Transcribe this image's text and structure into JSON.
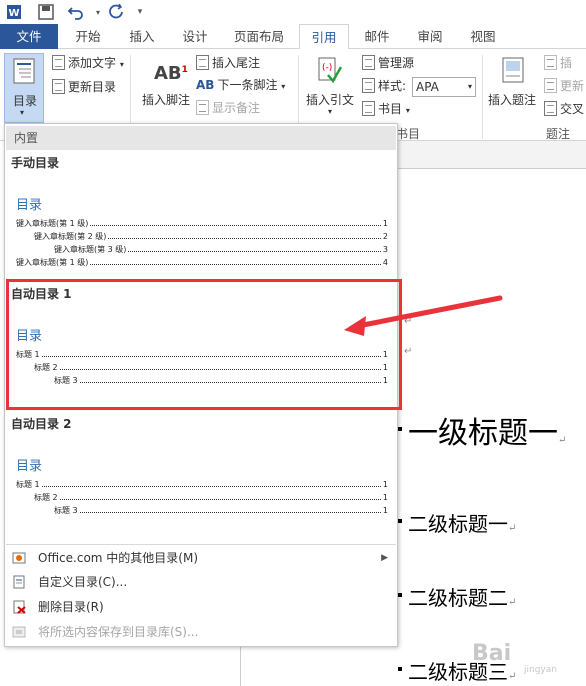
{
  "qat": {
    "icons": [
      "word-icon",
      "save-icon",
      "undo-icon",
      "redo-icon",
      "customize-icon"
    ]
  },
  "tabs": [
    {
      "label": "文件",
      "state": "file"
    },
    {
      "label": "开始",
      "state": ""
    },
    {
      "label": "插入",
      "state": ""
    },
    {
      "label": "设计",
      "state": ""
    },
    {
      "label": "页面布局",
      "state": ""
    },
    {
      "label": "引用",
      "state": "active"
    },
    {
      "label": "邮件",
      "state": ""
    },
    {
      "label": "审阅",
      "state": ""
    },
    {
      "label": "视图",
      "state": ""
    }
  ],
  "ribbon": {
    "toc_button": "目录",
    "add_text": "添加文字",
    "update_toc": "更新目录",
    "insert_footnote": "插入脚注",
    "insert_endnote": "插入尾注",
    "next_footnote": "下一条脚注",
    "show_notes": "显示备注",
    "insert_citation": "插入引文",
    "manage_sources": "管理源",
    "style_label": "样式:",
    "style_value": "APA",
    "bibliography": "书目",
    "group_citations": "书目",
    "insert_caption": "插入题注",
    "group_captions": "题注",
    "caption_right_1": "插",
    "caption_right_2": "更新",
    "caption_right_3": "交叉"
  },
  "gallery": {
    "header": "内置",
    "options": [
      {
        "title": "手动目录",
        "toc_heading": "目录",
        "rows": [
          {
            "text": "键入章标题(第 1 级)",
            "page": "1",
            "level": 1
          },
          {
            "text": "键入章标题(第 2 级)",
            "page": "2",
            "level": 2
          },
          {
            "text": "键入章标题(第 3 级)",
            "page": "3",
            "level": 3
          },
          {
            "text": "键入章标题(第 1 级)",
            "page": "4",
            "level": 1
          }
        ]
      },
      {
        "title": "自动目录 1",
        "toc_heading": "目录",
        "rows": [
          {
            "text": "标题 1",
            "page": "1",
            "level": 1
          },
          {
            "text": "标题 2",
            "page": "1",
            "level": 2
          },
          {
            "text": "标题 3",
            "page": "1",
            "level": 3
          }
        ]
      },
      {
        "title": "自动目录 2",
        "toc_heading": "目录",
        "rows": [
          {
            "text": "标题 1",
            "page": "1",
            "level": 1
          },
          {
            "text": "标题 2",
            "page": "1",
            "level": 2
          },
          {
            "text": "标题 3",
            "page": "1",
            "level": 3
          }
        ]
      }
    ],
    "menu": [
      {
        "label": "Office.com 中的其他目录(M)",
        "icon": "office-icon",
        "disabled": false,
        "submenu": true
      },
      {
        "label": "自定义目录(C)...",
        "icon": "toc-icon",
        "disabled": false,
        "submenu": false
      },
      {
        "label": "删除目录(R)",
        "icon": "delete-toc-icon",
        "disabled": false,
        "submenu": false
      },
      {
        "label": "将所选内容保存到目录库(S)...",
        "icon": "save-selection-icon",
        "disabled": true,
        "submenu": false
      }
    ]
  },
  "document": {
    "heading1": "一级标题一",
    "heading2": [
      "二级标题一",
      "二级标题二",
      "二级标题三"
    ],
    "para_mark": "↵"
  },
  "colors": {
    "accent": "#2b579a",
    "highlight": "#e8333a",
    "toc_heading": "#2e74b5"
  }
}
